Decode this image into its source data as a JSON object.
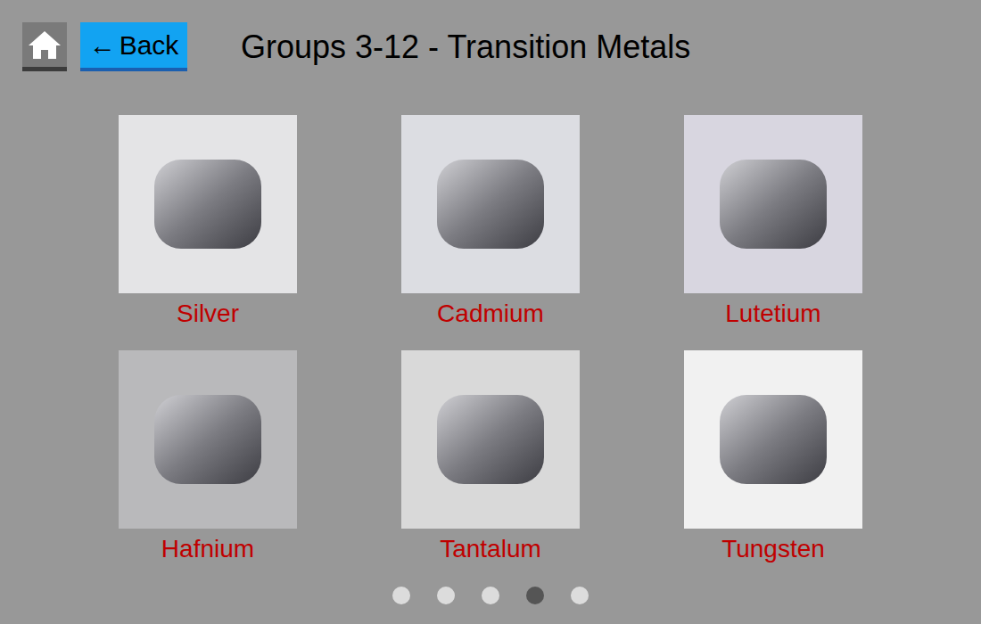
{
  "header": {
    "title": "Groups 3-12 - Transition Metals",
    "back": {
      "icon": "←",
      "label": "Back"
    }
  },
  "elements": [
    {
      "name": "Silver"
    },
    {
      "name": "Cadmium"
    },
    {
      "name": "Lutetium"
    },
    {
      "name": "Hafnium"
    },
    {
      "name": "Tantalum"
    },
    {
      "name": "Tungsten"
    }
  ],
  "pagination": [
    {
      "selected": false
    },
    {
      "selected": false
    },
    {
      "selected": false
    },
    {
      "selected": true
    },
    {
      "selected": false
    }
  ]
}
